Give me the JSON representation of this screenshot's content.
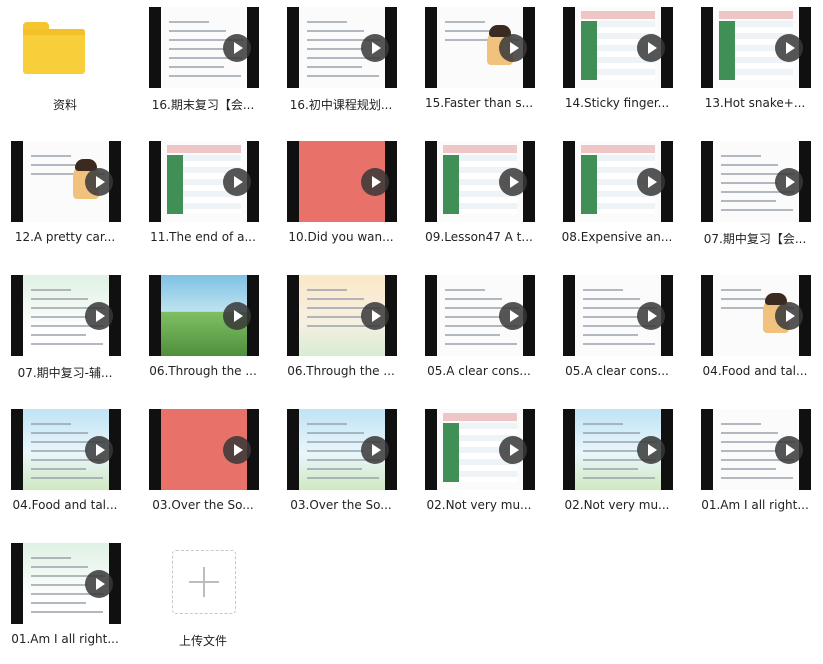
{
  "files": [
    {
      "name": "资料",
      "type": "folder"
    },
    {
      "name": "16.期末复习【会...",
      "type": "video",
      "style": "plain"
    },
    {
      "name": "16.初中课程规划...",
      "type": "video",
      "style": "plain"
    },
    {
      "name": "15.Faster than s...",
      "type": "video",
      "style": "figure"
    },
    {
      "name": "14.Sticky finger...",
      "type": "video",
      "style": "table"
    },
    {
      "name": "13.Hot snake+...",
      "type": "video",
      "style": "table"
    },
    {
      "name": "12.A pretty car...",
      "type": "video",
      "style": "figure"
    },
    {
      "name": "11.The end of a...",
      "type": "video",
      "style": "table"
    },
    {
      "name": "10.Did you wan...",
      "type": "video",
      "style": "red"
    },
    {
      "name": "09.Lesson47 A t...",
      "type": "video",
      "style": "table"
    },
    {
      "name": "08.Expensive an...",
      "type": "video",
      "style": "table"
    },
    {
      "name": "07.期中复习【会...",
      "type": "video",
      "style": "plain"
    },
    {
      "name": "07.期中复习-辅...",
      "type": "video",
      "style": "green"
    },
    {
      "name": "06.Through the ...",
      "type": "video",
      "style": "scene"
    },
    {
      "name": "06.Through the ...",
      "type": "video",
      "style": "warm"
    },
    {
      "name": "05.A clear cons...",
      "type": "video",
      "style": "plain"
    },
    {
      "name": "05.A clear cons...",
      "type": "video",
      "style": "plain"
    },
    {
      "name": "04.Food and tal...",
      "type": "video",
      "style": "figure"
    },
    {
      "name": "04.Food and tal...",
      "type": "video",
      "style": "sky"
    },
    {
      "name": "03.Over the So...",
      "type": "video",
      "style": "red"
    },
    {
      "name": "03.Over the So...",
      "type": "video",
      "style": "sky"
    },
    {
      "name": "02.Not very mu...",
      "type": "video",
      "style": "table"
    },
    {
      "name": "02.Not very mu...",
      "type": "video",
      "style": "sky"
    },
    {
      "name": "01.Am I all right...",
      "type": "video",
      "style": "plain"
    },
    {
      "name": "01.Am I all right...",
      "type": "video",
      "style": "green"
    },
    {
      "name": "上传文件",
      "type": "upload"
    }
  ]
}
